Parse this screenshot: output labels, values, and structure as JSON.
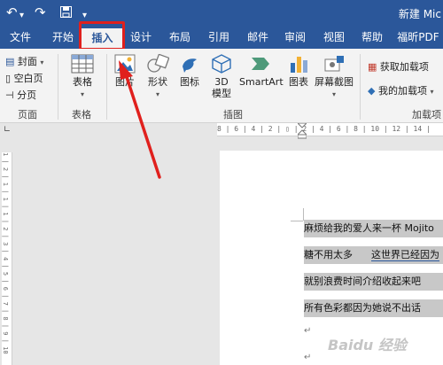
{
  "titlebar": {
    "doc_title": "新建 Mic",
    "qat": {
      "save_icon": "save-icon",
      "undo_icon": "undo-icon",
      "redo_icon": "redo-icon"
    }
  },
  "tabs": [
    "文件",
    "开始",
    "插入",
    "设计",
    "布局",
    "引用",
    "邮件",
    "审阅",
    "视图",
    "帮助",
    "福昕PDF"
  ],
  "active_tab": "插入",
  "ribbon": {
    "pages_group": {
      "cover": "封面",
      "blank": "空白页",
      "break": "分页",
      "label": "页面"
    },
    "table_group": {
      "table": "表格",
      "label": "表格"
    },
    "illustrations_group": {
      "picture": "图片",
      "shapes": "形状",
      "icons": "图标",
      "model3d_line1": "3D",
      "model3d_line2": "模型",
      "smartart": "SmartArt",
      "chart": "图表",
      "screenshot": "屏幕截图",
      "label": "插图"
    },
    "addins_group": {
      "get": "获取加载项",
      "my": "我的加载项",
      "label": "加载项"
    }
  },
  "ruler_h": "8 | 6 | 4 | 2 | ▯ | 2 | 4 | 6 | 8 | 10 | 12 | 14 |",
  "ruler_v": "1 | 2 | 1 | 1 | 1 | 2 | 3 | 4 | 5 | 6 | 7 | 8 | 9 | 10",
  "document": {
    "lines": [
      "麻烦给我的爱人来一杯 Mojito",
      "糖不用太多",
      "这世界已经因为",
      "就别浪费时间介绍收起来吧",
      "所有色彩都因为她说不出话"
    ],
    "para_mark": "↵"
  },
  "watermark": "Baidu 经验",
  "colors": {
    "accent": "#2b579a",
    "highlight": "#e0201d",
    "selection": "#c8c8c8"
  }
}
